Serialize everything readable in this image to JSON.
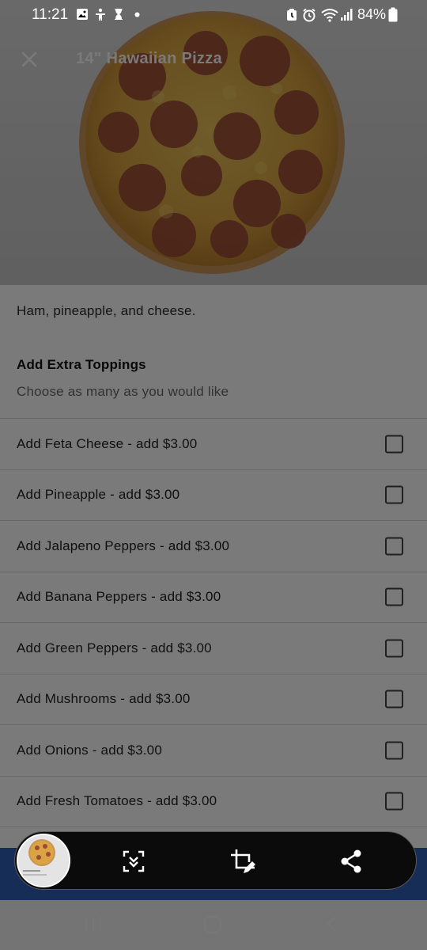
{
  "status_bar": {
    "time": "11:21",
    "battery": "84%",
    "left_icons": [
      "image-icon",
      "accessibility-icon",
      "hourglass-icon",
      "dot-icon"
    ],
    "right_icons": [
      "alarm-badge-icon",
      "alarm-clock-icon",
      "wifi-icon",
      "signal-icon",
      "battery-icon"
    ]
  },
  "header": {
    "title": "14\" Hawaiian Pizza",
    "close_icon": "close-icon"
  },
  "item": {
    "description": "Ham, pineapple, and cheese."
  },
  "toppings": {
    "title": "Add Extra Toppings",
    "subtitle": "Choose as many as you would like",
    "options": [
      {
        "label": "Add Feta Cheese - add $3.00",
        "checked": false
      },
      {
        "label": "Add Pineapple - add $3.00",
        "checked": false
      },
      {
        "label": "Add Jalapeno Peppers - add $3.00",
        "checked": false
      },
      {
        "label": "Add Banana Peppers - add $3.00",
        "checked": false
      },
      {
        "label": "Add Green Peppers - add $3.00",
        "checked": false
      },
      {
        "label": "Add Mushrooms - add $3.00",
        "checked": false
      },
      {
        "label": "Add Onions - add $3.00",
        "checked": false
      },
      {
        "label": "Add Fresh Tomatoes - add $3.00",
        "checked": false
      }
    ]
  },
  "screenshot_toolbar": {
    "buttons": [
      "scroll-capture-icon",
      "crop-edit-icon",
      "share-icon"
    ]
  },
  "nav_bar": {
    "keys": [
      "recents-icon",
      "home-icon",
      "back-icon"
    ]
  },
  "colors": {
    "accent_blue": "#2c5fb7",
    "dim_overlay": "rgba(0,0,0,0.52)"
  }
}
